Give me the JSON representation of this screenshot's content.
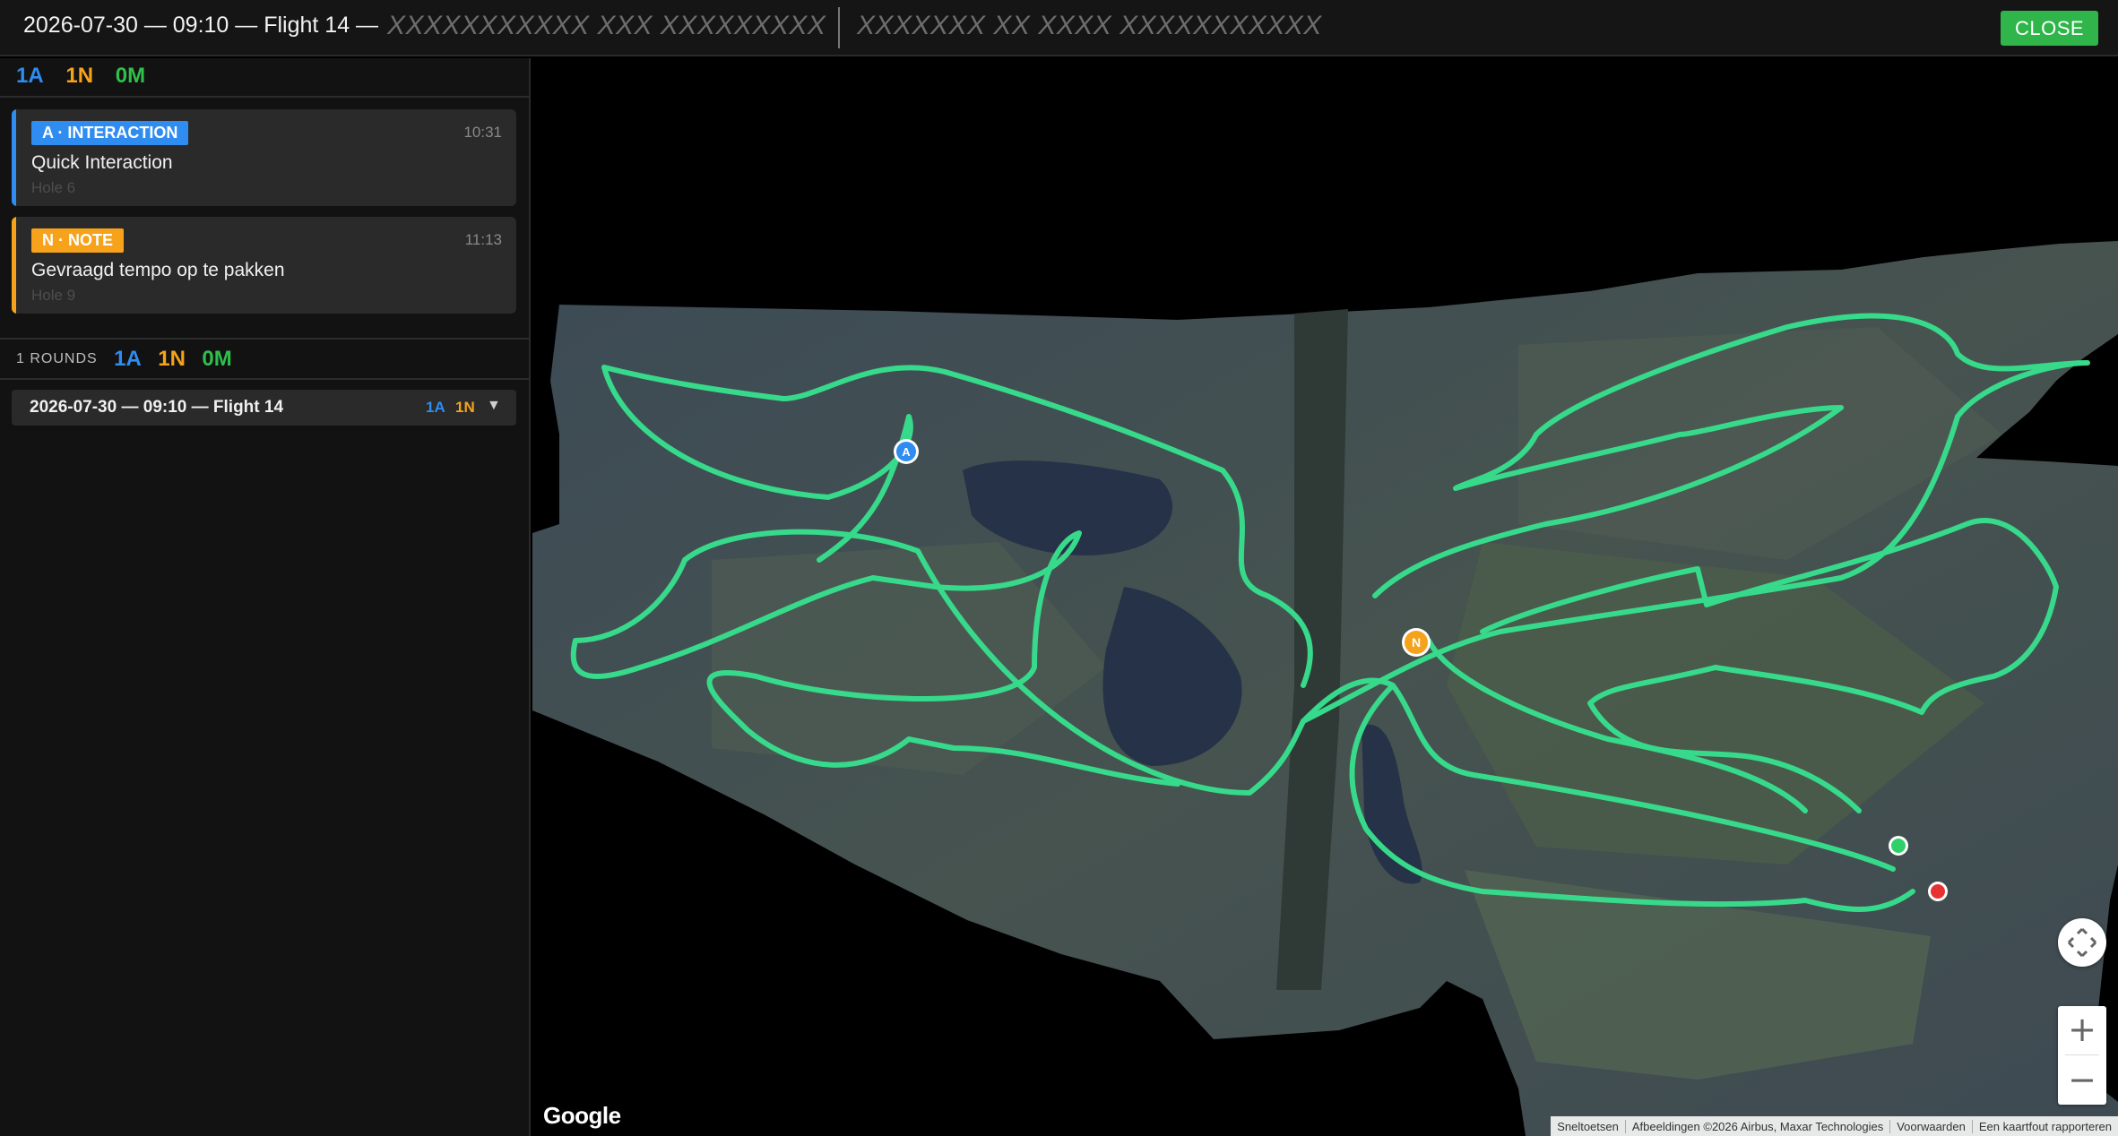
{
  "header": {
    "title": "2026-07-30 — 09:10 — Flight 14 —",
    "redacted_1": "XXXXXXXXXXX XXX XXXXXXXXX",
    "redacted_2": "XXXXXXX XX XXXX XXXXXXXXXXX",
    "close_label": "CLOSE"
  },
  "counts": {
    "a": "1A",
    "n": "1N",
    "m": "0M"
  },
  "events": [
    {
      "type": "A",
      "badge": "A · INTERACTION",
      "time": "10:31",
      "text": "Quick Interaction",
      "hole": "Hole 6",
      "color": "#2f8cf0"
    },
    {
      "type": "N",
      "badge": "N · NOTE",
      "time": "11:13",
      "text": "Gevraagd tempo op te pakken",
      "hole": "Hole 9",
      "color": "#f6a21b"
    }
  ],
  "rounds": {
    "label": "1 ROUNDS",
    "a": "1A",
    "n": "1N",
    "m": "0M",
    "items": [
      {
        "name": "2026-07-30 — 09:10 — Flight 14",
        "a": "1A",
        "n": "1N",
        "chevron": "▼"
      }
    ]
  },
  "map": {
    "google_label": "Google",
    "attribution": [
      "Sneltoetsen",
      "Afbeeldingen ©2026 Airbus, Maxar Technologies",
      "Voorwaarden",
      "Een kaartfout rapporteren"
    ],
    "markers": [
      {
        "label": "A",
        "color": "#2f8cf0"
      },
      {
        "label": "N",
        "color": "#f6a21b"
      },
      {
        "label": "",
        "color": "#2fd06a",
        "role": "start"
      },
      {
        "label": "",
        "color": "#e63232",
        "role": "end"
      }
    ],
    "track_color": "#37d98a",
    "zoom_in": "+",
    "zoom_out": "−"
  }
}
